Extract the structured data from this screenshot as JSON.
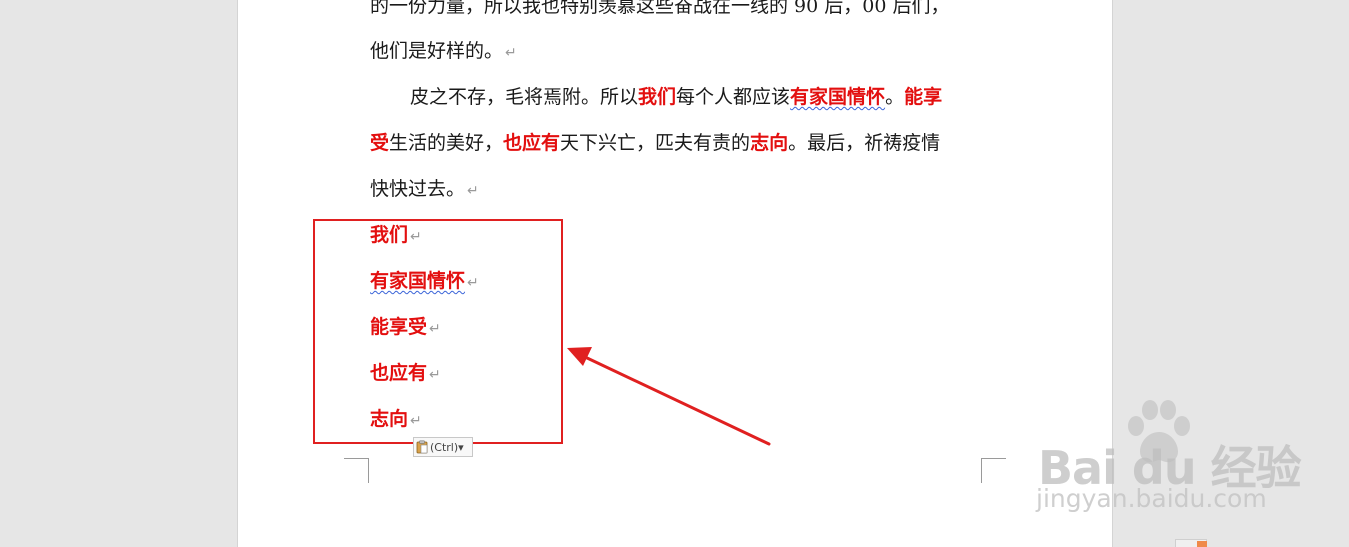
{
  "document": {
    "line1_prefix": "的一份力量，所以我也特别羡慕这些奋战在一线的 90 后，00 后们，",
    "line2": "他们是好样的。",
    "line3_a": "皮之不存，毛将焉附。所以",
    "line3_b": "我们",
    "line3_c": "每个人都应该",
    "line3_d": "有家国情怀",
    "line3_e": "。",
    "line3_f": "能享",
    "line4_a": "受",
    "line4_b": "生活的美好，",
    "line4_c": "也应有",
    "line4_d": "天下兴亡，匹夫有责的",
    "line4_e": "志向",
    "line4_f": "。最后，祈祷疫情",
    "line5": "快快过去。",
    "paragraph_mark": "↵"
  },
  "pasted_items": [
    "我们",
    "有家国情怀",
    "能享受",
    "也应有",
    "志向"
  ],
  "paste_options": {
    "label": "(Ctrl)▾"
  },
  "watermark": {
    "brand": "Bai  du 经验",
    "url": "jingyan.baidu.com"
  },
  "colors": {
    "highlight": "#e30f0f",
    "annotation": "#e02020",
    "page": "#ffffff",
    "background": "#e6e6e6"
  }
}
